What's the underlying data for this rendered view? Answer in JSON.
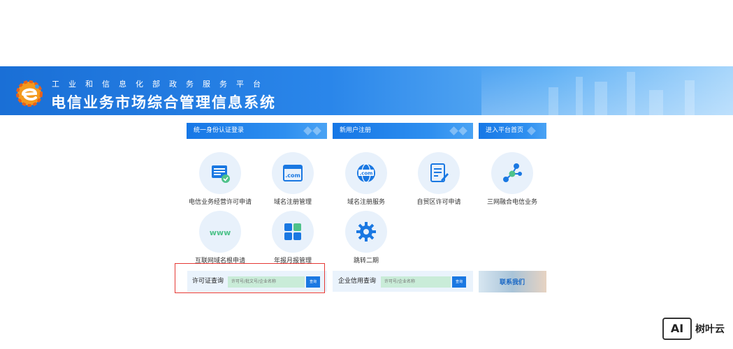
{
  "header": {
    "subtitle": "工业和信息化部政务服务平台",
    "title": "电信业务市场综合管理信息系统"
  },
  "topbars": {
    "login": "统一身份认证登录",
    "register": "新用户注册",
    "home": "进入平台首页"
  },
  "services": [
    {
      "label": "电信业务经营许可申请",
      "icon": "license-document-icon"
    },
    {
      "label": "域名注册管理",
      "icon": "dotcom-window-icon"
    },
    {
      "label": "域名注册服务",
      "icon": "globe-dotcom-icon"
    },
    {
      "label": "自贸区许可申请",
      "icon": "edit-document-icon"
    },
    {
      "label": "三网融合电信业务",
      "icon": "network-nodes-icon"
    },
    {
      "label": "互联网域名根申请",
      "icon": "www-icon"
    },
    {
      "label": "年报月报管理",
      "icon": "grid-squares-icon"
    },
    {
      "label": "跳转二期",
      "icon": "gear-icon"
    }
  ],
  "search": {
    "license": {
      "label": "许可证查询",
      "placeholder": "许可号/批文号/企业名称",
      "button": "查询"
    },
    "credit": {
      "label": "企业信用查询",
      "placeholder": "许可号/企业名称",
      "button": "查询"
    }
  },
  "contact": {
    "label": "联系我们"
  },
  "watermark": {
    "logo": "AI",
    "text": "树叶云"
  },
  "colors": {
    "primary": "#1a78e2",
    "highlight": "#e53935",
    "icon_bg": "#e8f1fb",
    "input_bg": "#c9ecd8"
  }
}
